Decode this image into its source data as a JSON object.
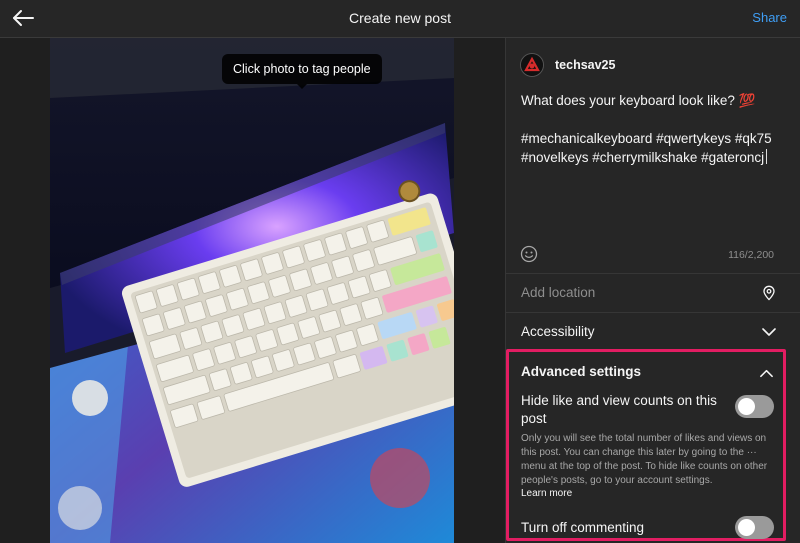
{
  "header": {
    "title": "Create new post",
    "share_label": "Share",
    "back_icon": "arrow-left-icon"
  },
  "media": {
    "tooltip": "Click photo to tag people"
  },
  "user": {
    "username": "techsav25"
  },
  "caption": {
    "text": "What does your keyboard look like? 💯\n\n#mechanicalkeyboard #qwertykeys #qk75 #novelkeys #cherrymilkshake #gateroncj",
    "char_count": "116/2,200",
    "emoji_icon": "smiley-icon"
  },
  "location": {
    "placeholder": "Add location",
    "icon": "location-pin-icon"
  },
  "accessibility": {
    "label": "Accessibility",
    "icon": "chevron-down-icon"
  },
  "advanced": {
    "title": "Advanced settings",
    "icon": "chevron-up-icon",
    "hide_counts_label": "Hide like and view counts on this post",
    "hide_counts_on": false,
    "info": "Only you will see the total number of likes and views on this post. You can change this later by going to the ··· menu at the top of the post. To hide like counts on other people's posts, go to your account settings.",
    "learn_more": "Learn more",
    "comment_label": "Turn off commenting",
    "comment_off": false
  },
  "colors": {
    "accent": "#3f9ef5",
    "highlight": "#e21d62",
    "background": "#262626"
  }
}
